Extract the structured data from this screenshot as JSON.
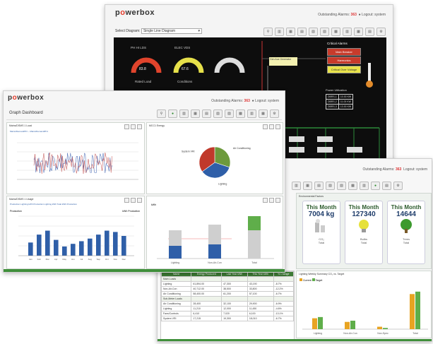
{
  "colors": {
    "brand_red": "#e23a2a",
    "accent_green": "#3f8f3a",
    "dark_bg": "#111111",
    "bar_blue": "#2f5fa8",
    "bar_gray": "#cfcfcf",
    "bar_green": "#5fae4a",
    "bar_orange": "#e8a422"
  },
  "back_window": {
    "logo": "powerbox",
    "outstanding_label": "Outstanding Alarms:",
    "outstanding_count": "363",
    "logout": "Logout: system",
    "select_label": "Select Diagram:",
    "select_value": "Single Line Diagram",
    "gauges": [
      {
        "top": "PH HI LDS",
        "value": "83.8",
        "sub": "Rated Load"
      },
      {
        "top": "ELEC VDS",
        "value": "67.6",
        "sub": "Conditions"
      },
      {
        "top": "",
        "value": "",
        "sub": ""
      }
    ],
    "critical_title": "Critical Alarms",
    "critical_items": [
      "Main Breaker",
      "Harmonics",
      "Critical Over Voltage"
    ],
    "power_title": "Power Utilization",
    "power_rows": [
      [
        "DBRS-1",
        "10.00 KW"
      ],
      [
        "DBRS-2",
        "11.00 KW"
      ],
      [
        "DBRS-3",
        "13.00 KW"
      ]
    ],
    "side_box": "Gen Aux Generator"
  },
  "graph_window": {
    "logo": "powerbox",
    "outstanding_label": "Outstanding Alarms:",
    "outstanding_count": "363",
    "logout": "Logout: system",
    "title": "Graph Dashboard",
    "panels": {
      "tl_title": "Mains/DSMS 1 Load",
      "tr_title": "MCC1 Energy",
      "bl_title": "Mains/DSMS 1 Usage",
      "br_title": ""
    },
    "legend_tl": "Mains/DemandPFl  --  Mains/DemandPF1",
    "legend_bl": "Production  Lighting kWh Production  Lighting kWh  Total kWh Production",
    "bl_left_label": "Production",
    "bl_right_label": "kWh Production",
    "br_ylabel": "kWh",
    "br_categories": [
      "Lighting",
      "Non-Air-Con",
      "Total"
    ]
  },
  "pie_chart": {
    "type": "pie",
    "slices": [
      {
        "label": "Air Conditioning",
        "value": 30,
        "color": "#6d9a3c"
      },
      {
        "label": "Lighting",
        "value": 35,
        "color": "#2f5fa8"
      },
      {
        "label": "System VRI",
        "value": 35,
        "color": "#c0392b"
      }
    ]
  },
  "bar_chart_usage": {
    "type": "bar",
    "categories": [
      "Jan",
      "Feb",
      "Mar",
      "Apr",
      "May",
      "Jun",
      "Jul",
      "Aug",
      "Sep",
      "Oct",
      "Nov",
      "Dec"
    ],
    "values": [
      20,
      32,
      38,
      24,
      14,
      18,
      22,
      26,
      32,
      38,
      36,
      30
    ],
    "ylim": [
      0,
      60
    ]
  },
  "stacked_chart": {
    "type": "bar",
    "categories": [
      "Lighting",
      "Non-Air-Con",
      "Total"
    ],
    "series": [
      {
        "name": "Blue",
        "values": [
          18,
          20,
          0
        ]
      },
      {
        "name": "Gray",
        "values": [
          22,
          28,
          40
        ]
      },
      {
        "name": "Green",
        "values": [
          0,
          0,
          20
        ]
      }
    ],
    "ylim": [
      0,
      70
    ]
  },
  "right_window": {
    "outstanding_label": "Outstanding Alarms:",
    "outstanding_count": "363",
    "logout": "Logout: system",
    "section_title": "Environmental Factors",
    "kpis": [
      {
        "month": "This Month",
        "value": "7004 kg",
        "unit": "CO₂",
        "foot": "Total"
      },
      {
        "month": "This Month",
        "value": "127340",
        "unit": "Bulbs",
        "foot": "Total"
      },
      {
        "month": "This Month",
        "value": "14644",
        "unit": "Trees",
        "foot": "Total"
      }
    ],
    "bottom_title": "Lighting Weekly Summary CO₂ vs. Target",
    "legend": [
      "Current",
      "Target"
    ],
    "categories": [
      "Lighting",
      "Non-Air-Con",
      "Non-Spec",
      "Total"
    ]
  },
  "bar_chart_weekly": {
    "type": "bar",
    "categories": [
      "Lighting",
      "Non-Air-Con",
      "Non-Spec",
      "Total"
    ],
    "series": [
      {
        "name": "Current",
        "values": [
          18,
          12,
          4,
          58
        ]
      },
      {
        "name": "Target",
        "values": [
          20,
          14,
          2,
          62
        ]
      }
    ],
    "ylim": [
      0,
      70
    ]
  },
  "table": {
    "headers": [
      "Name",
      "Energy Produced",
      "Last Year kWh",
      "This Year kWh",
      "% Change"
    ],
    "rows": [
      [
        "Main Loads",
        "",
        "",
        "",
        ""
      ],
      [
        "Lighting",
        "61,894.00",
        "47,300",
        "43,190",
        "-8.7%"
      ],
      [
        "Non-Air-Con",
        "40,712.00",
        "38,500",
        "33,800",
        "-12.2%"
      ],
      [
        "Air Conditioning",
        "58,400.00",
        "61,200",
        "57,100",
        "-6.7%"
      ],
      [
        "Sub-Meter Loads",
        "",
        "",
        "",
        ""
      ],
      [
        "Air Conditioning",
        "28,400",
        "32,100",
        "29,900",
        "-6.9%"
      ],
      [
        "Lighting",
        "11,210",
        "12,000",
        "11,450",
        "-4.6%"
      ],
      [
        "Fans/Controls",
        "6,410",
        "7,020",
        "6,100",
        "-13.1%"
      ],
      [
        "System VRI",
        "17,215",
        "19,300",
        "18,010",
        "-6.7%"
      ]
    ]
  }
}
